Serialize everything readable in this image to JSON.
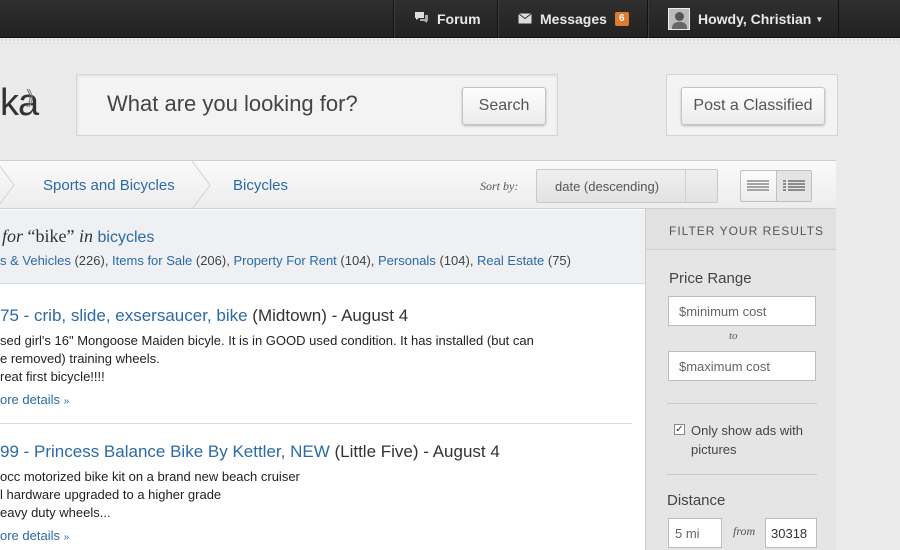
{
  "topbar": {
    "forum_label": "Forum",
    "messages_label": "Messages",
    "messages_count": "6",
    "user_greeting": "Howdy, Christian"
  },
  "logo": {
    "text": "ka"
  },
  "search": {
    "placeholder": "What are you looking for?",
    "button_label": "Search"
  },
  "post_button_label": "Post a Classified",
  "breadcrumb": [
    "Sports and Bicycles",
    "Bicycles"
  ],
  "sort": {
    "label": "Sort by:",
    "value": "date (descending)"
  },
  "results": {
    "prefix": "for",
    "query": "“bike”",
    "in_word": "in",
    "category": "bicycles",
    "categories": [
      {
        "name": "s & Vehicles",
        "count": "(226)"
      },
      {
        "name": "Items for Sale",
        "count": "(206)"
      },
      {
        "name": "Property For Rent",
        "count": "(104)"
      },
      {
        "name": "Personals",
        "count": "(104)"
      },
      {
        "name": "Real Estate",
        "count": "(75)"
      }
    ]
  },
  "listings": [
    {
      "title_link": "75 - crib, slide, exsersaucer, bike",
      "location_date": " (Midtown) - August 4",
      "lines": [
        "sed girl's 16\" Mongoose Maiden bicyle. It is in GOOD used condition. It has installed (but can",
        "e removed) training wheels.",
        "reat first bicycle!!!!"
      ],
      "more": "ore details"
    },
    {
      "title_link": "99 - Princess Balance Bike By Kettler, NEW",
      "location_date": " (Little Five) - August 4",
      "lines": [
        "occ motorized bike kit on a brand new beach cruiser",
        "l hardware upgraded to a higher grade",
        "eavy duty wheels..."
      ],
      "more": "ore details"
    }
  ],
  "filter": {
    "heading": "FILTER YOUR RESULTS",
    "price_label": "Price Range",
    "min_placeholder": "$minimum cost",
    "to_label": "to",
    "max_placeholder": "$maximum cost",
    "pictures_label": "Only show ads with pictures",
    "pictures_checked": true,
    "distance_label": "Distance",
    "distance_value": "5 mi",
    "from_label": "from",
    "zip_value": "30318"
  }
}
